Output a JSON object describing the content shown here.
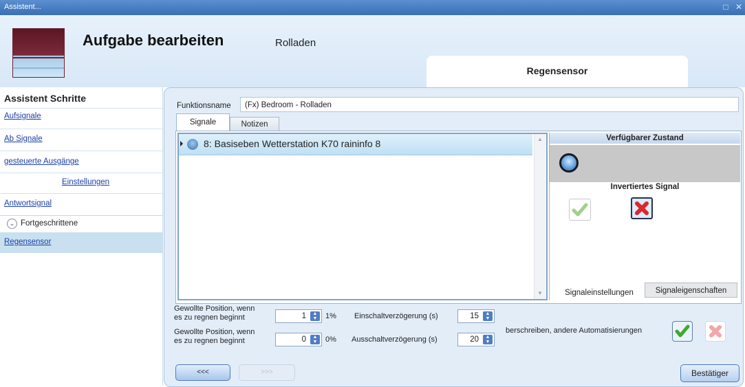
{
  "window": {
    "title": "Assistent...",
    "icons": [
      "restore-icon",
      "close-icon"
    ]
  },
  "header": {
    "title": "Aufgabe bearbeiten",
    "subtitle": "Rolladen",
    "tab_label": "Regensensor",
    "logo_icon": "rolladen-icon"
  },
  "sidebar": {
    "title": "Assistent Schritte",
    "items": [
      {
        "label": "Aufsignale"
      },
      {
        "label": "Ab Signale"
      },
      {
        "label": "gesteuerte Ausgänge"
      },
      {
        "label": "Einstellungen"
      },
      {
        "label": "Antwortsignal"
      }
    ],
    "advanced_label": "Fortgeschrittene",
    "active_item": "Regensensor"
  },
  "main": {
    "function_label": "Funktionsname",
    "function_value": "(Fx) Bedroom - Rolladen",
    "tabs": [
      {
        "label": "Signale"
      },
      {
        "label": "Notizen"
      }
    ],
    "signal": {
      "text": "8: Basiseben Wetterstation K70 raininfo 8",
      "icon": "sensor-icon"
    },
    "right_panel": {
      "available_state_title": "Verfügbarer Zustand",
      "state_icon": "circle-state-icon",
      "inverted_title": "Invertiertes Signal",
      "tabs": [
        {
          "label": "Signaleinstellungen"
        },
        {
          "label": "Signaleigenschaften"
        }
      ]
    },
    "controls": {
      "position1": {
        "label_line1": "Gewollte Position, wenn",
        "label_line2": "es zu regnen beginnt",
        "value": "1",
        "unit": "1%"
      },
      "position2": {
        "label_line1": "Gewollte Position, wenn",
        "label_line2": "es zu regnen beginnt",
        "value": "0",
        "unit": "0%"
      },
      "delay_on": {
        "label": "Einschaltverzögerung (s)",
        "value": "15"
      },
      "delay_off": {
        "label": "Ausschaltverzögerung (s)",
        "value": "20"
      },
      "override_label": "berschreiben, andere Automatisierungen"
    },
    "buttons": {
      "prev": "<<<",
      "next": ">>>",
      "confirm": "Bestätiger"
    }
  },
  "colors": {
    "accent": "#3a6fb6",
    "panel": "#e2edf8",
    "selection": "#c8e0ef",
    "check_green": "#4caf50",
    "cross_red": "#d9282e"
  }
}
